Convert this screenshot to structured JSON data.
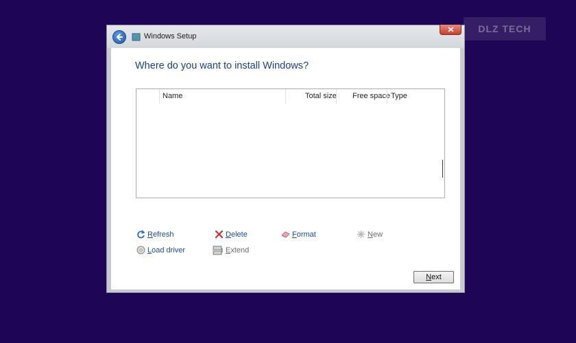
{
  "watermark": {
    "text": "DLZ TECH"
  },
  "window": {
    "title": "Windows Setup",
    "icons": {
      "back": "back-arrow-icon",
      "app": "windows-setup-icon",
      "close": "close-icon"
    }
  },
  "main": {
    "heading": "Where do you want to install Windows?",
    "table": {
      "columns": [
        "Name",
        "Total size",
        "Free space",
        "Type"
      ],
      "rows": []
    },
    "actions": {
      "refresh": "Refresh",
      "delete": "Delete",
      "format": "Format",
      "new": "New",
      "load_driver": "Load driver",
      "extend": "Extend"
    },
    "next_label": "Next"
  },
  "colors": {
    "background": "#1f0555",
    "heading": "#1b3f8a",
    "link": "#1c4aa8"
  }
}
